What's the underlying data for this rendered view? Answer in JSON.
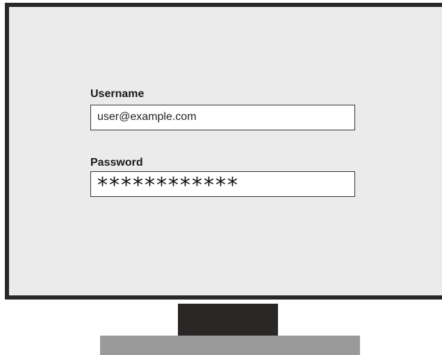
{
  "login_form": {
    "username_label": "Username",
    "username_value": "user@example.com",
    "password_label": "Password",
    "password_masked": "************"
  },
  "colors": {
    "screen_background": "#ebebeb",
    "monitor_frame": "#2a2727",
    "monitor_base": "#9a9a9a",
    "field_background": "#ffffff"
  }
}
